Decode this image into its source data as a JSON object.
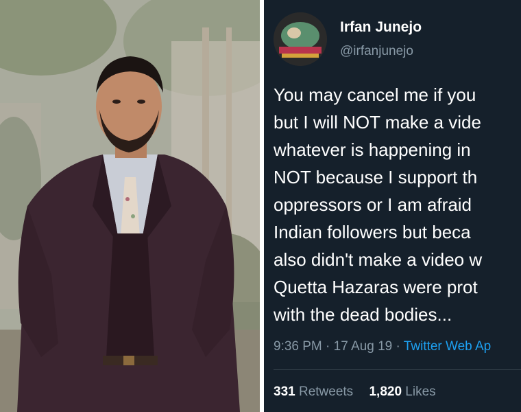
{
  "photo": {
    "alt_icon": "portrait-photo"
  },
  "tweet": {
    "display_name": "Irfan Junejo",
    "handle": "@irfanjunejo",
    "lines": [
      "You may cancel me if you",
      "but I will NOT make a vide",
      "whatever is happening in",
      "NOT because I support th",
      "oppressors or I am afraid",
      "Indian followers but beca",
      "also didn't make a video w",
      "Quetta Hazaras were prot",
      "with the dead bodies..."
    ],
    "time": "9:36 PM",
    "date": "17 Aug 19",
    "dot": "·",
    "client": "Twitter Web Ap",
    "retweets_count": "331",
    "retweets_label": "Retweets",
    "likes_count": "1,820",
    "likes_label": "Likes"
  },
  "colors": {
    "tweet_bg": "#15202b",
    "muted": "#8899a6",
    "link": "#1da1f2"
  }
}
